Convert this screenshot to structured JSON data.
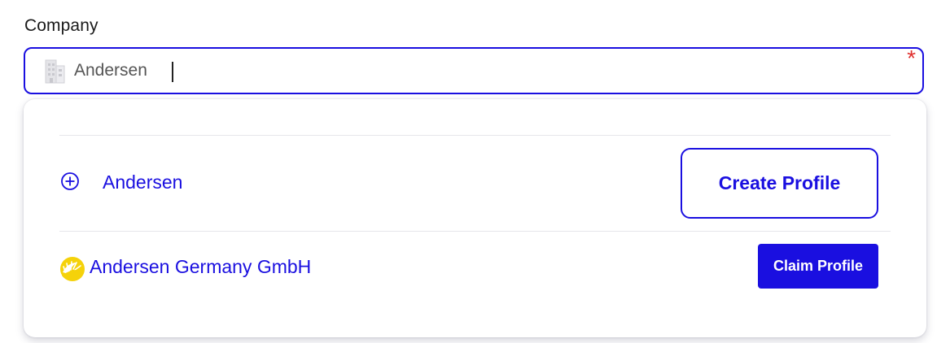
{
  "field": {
    "label": "Company",
    "value": "Andersen",
    "required_marker": "*"
  },
  "dropdown": {
    "create_option": {
      "name": "Andersen",
      "button_label": "Create Profile",
      "icon": "plus-circle-icon"
    },
    "results": [
      {
        "name": "Andersen Germany GmbH",
        "button_label": "Claim Profile",
        "logo": "sun-logo-icon"
      }
    ]
  },
  "colors": {
    "accent": "#1a0fe0",
    "required": "#e0312f",
    "logo_yellow": "#f5d20a"
  }
}
